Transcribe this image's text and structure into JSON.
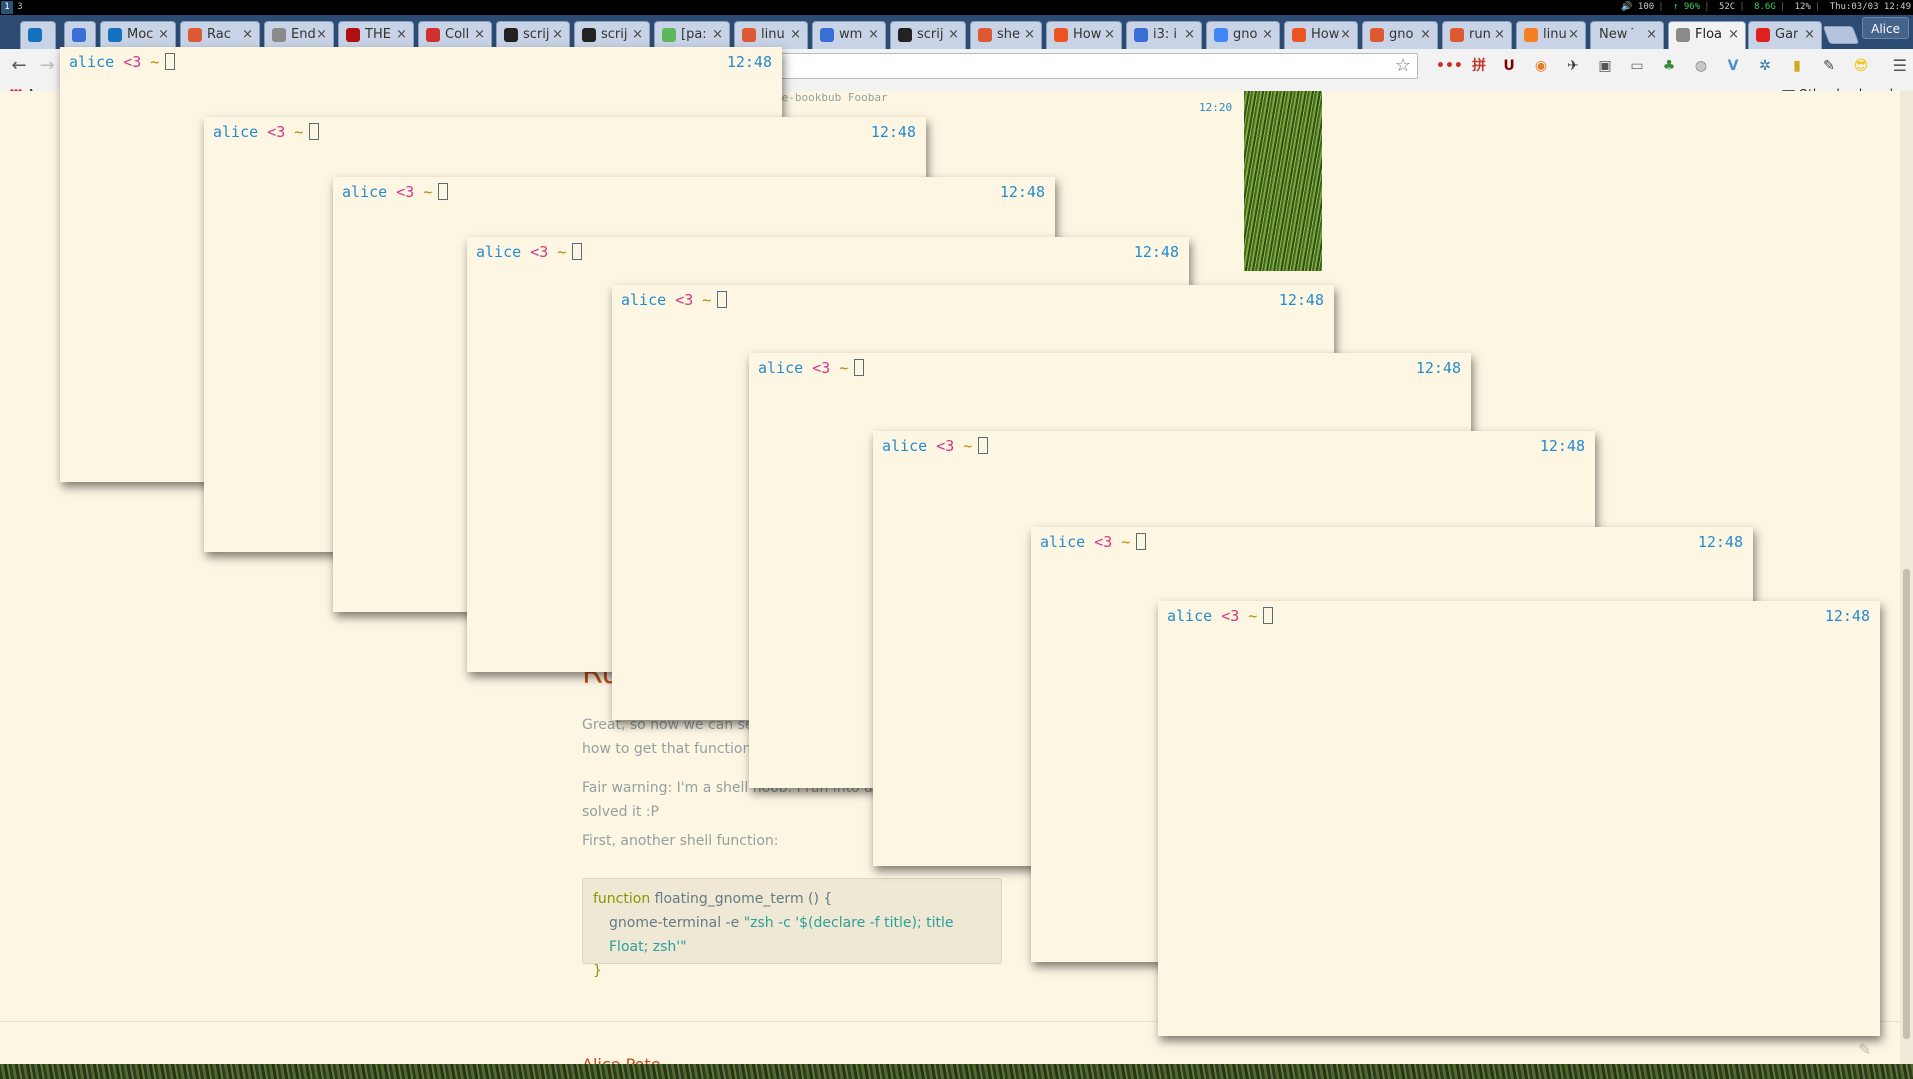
{
  "i3bar": {
    "workspaces": [
      "1",
      "3"
    ],
    "status": {
      "volume": "🔊 100",
      "wifi": "↑ 96%",
      "temp": "52C",
      "mem": "8.6G",
      "cpu": "12%",
      "datetime": "Thu:03/03 12:49"
    }
  },
  "tabs": [
    {
      "label": "",
      "favicon": "trello",
      "color": "#1570c0"
    },
    {
      "label": "",
      "favicon": "calendar",
      "color": "#3a6fd8"
    },
    {
      "label": "Moc",
      "favicon": "trello",
      "color": "#1570c0"
    },
    {
      "label": "Rac",
      "favicon": "duckduckgo",
      "color": "#de5833"
    },
    {
      "label": "End",
      "favicon": "doc",
      "color": "#8a8a8a"
    },
    {
      "label": "THE",
      "favicon": "the",
      "color": "#b01010"
    },
    {
      "label": "Coll",
      "favicon": "bb",
      "color": "#d03030"
    },
    {
      "label": "scrij",
      "favicon": "github",
      "color": "#222222"
    },
    {
      "label": "scrij",
      "favicon": "github",
      "color": "#222222"
    },
    {
      "label": "[pa:",
      "favicon": "check",
      "color": "#5cb85c"
    },
    {
      "label": "linu",
      "favicon": "duckduckgo",
      "color": "#de5833"
    },
    {
      "label": "wm",
      "favicon": "wm",
      "color": "#3a6fd8"
    },
    {
      "label": "scrij",
      "favicon": "github",
      "color": "#222222"
    },
    {
      "label": "she",
      "favicon": "duckduckgo",
      "color": "#de5833"
    },
    {
      "label": "How",
      "favicon": "askubuntu",
      "color": "#e95420"
    },
    {
      "label": "i3: i",
      "favicon": "i3",
      "color": "#3a6fd8"
    },
    {
      "label": "gno",
      "favicon": "google",
      "color": "#4285f4"
    },
    {
      "label": "How",
      "favicon": "askubuntu",
      "color": "#e95420"
    },
    {
      "label": "gno",
      "favicon": "duckduckgo",
      "color": "#de5833"
    },
    {
      "label": "run",
      "favicon": "duckduckgo",
      "color": "#de5833"
    },
    {
      "label": "linu",
      "favicon": "stackoverflow",
      "color": "#f48024"
    },
    {
      "label": "New Ta",
      "favicon": "",
      "color": ""
    },
    {
      "label": "Floa",
      "favicon": "page",
      "color": "#8a8a8a",
      "active": true
    },
    {
      "label": "Gar",
      "favicon": "record",
      "color": "#e02020"
    }
  ],
  "profile": "Alice",
  "toolbar": {
    "back": "←",
    "forward": "→",
    "bookmark_star": "☆",
    "menu": "☰",
    "extensions": [
      {
        "name": "lastpass-icon",
        "glyph": "•••",
        "color": "#d32d27"
      },
      {
        "name": "chinese-input-icon",
        "glyph": "拼",
        "color": "#c0392b"
      },
      {
        "name": "ublock-icon",
        "glyph": "U",
        "color": "#800000"
      },
      {
        "name": "color-picker-icon",
        "glyph": "◉",
        "color": "#e67e22"
      },
      {
        "name": "wrench-extension-icon",
        "glyph": "✈",
        "color": "#333333"
      },
      {
        "name": "screenshot-icon",
        "glyph": "▣",
        "color": "#555555"
      },
      {
        "name": "cast-icon",
        "glyph": "▭",
        "color": "#666666"
      },
      {
        "name": "tree-extension-icon",
        "glyph": "♣",
        "color": "#3a8a3a"
      },
      {
        "name": "globe-icon",
        "glyph": "◍",
        "color": "#888888"
      },
      {
        "name": "vimium-icon",
        "glyph": "V",
        "color": "#4a90d9"
      },
      {
        "name": "network-icon",
        "glyph": "✲",
        "color": "#2a6ea0"
      },
      {
        "name": "highlighter-icon",
        "glyph": "▮",
        "color": "#d4a820"
      },
      {
        "name": "eyedropper-icon",
        "glyph": "✎",
        "color": "#444444"
      },
      {
        "name": "sunglasses-icon",
        "glyph": "😎",
        "color": "#f1c40f"
      }
    ]
  },
  "bookmarks": {
    "apps": "Apps",
    "other": "Other bookmarks"
  },
  "page": {
    "crumb": "ce-bookbub Foobar",
    "prev_time": "12:20",
    "heading_partial": "Ru",
    "para1_line1": "Great, so now we can se",
    "para1_line2": "how to get that function t",
    "para2_line1": "Fair warning: I'm a shell noob. I ran into a t",
    "para2_line2": "solved it :P",
    "para3": "First, another shell function:",
    "code_line1_kw": "function",
    "code_line1_rest": " floating_gnome_term () {",
    "code_line2_cmd": "gnome-terminal -e ",
    "code_line2_str": "\"zsh -c '$(declare -f title); title Float; zsh'\"",
    "code_line3": "}",
    "author": "Alice Pote"
  },
  "terminals": [
    {
      "user": "alice",
      "heart": "<3",
      "dir": "~",
      "time": "12:48"
    },
    {
      "user": "alice",
      "heart": "<3",
      "dir": "~",
      "time": "12:48"
    },
    {
      "user": "alice",
      "heart": "<3",
      "dir": "~",
      "time": "12:48"
    },
    {
      "user": "alice",
      "heart": "<3",
      "dir": "~",
      "time": "12:48"
    },
    {
      "user": "alice",
      "heart": "<3",
      "dir": "~",
      "time": "12:48"
    },
    {
      "user": "alice",
      "heart": "<3",
      "dir": "~",
      "time": "12:48"
    },
    {
      "user": "alice",
      "heart": "<3",
      "dir": "~",
      "time": "12:48"
    },
    {
      "user": "alice",
      "heart": "<3",
      "dir": "~",
      "time": "12:48"
    },
    {
      "user": "alice",
      "heart": "<3",
      "dir": "~",
      "time": "12:48"
    }
  ],
  "colors": {
    "solarized_bg": "#fdf6e3",
    "user": "#268bd2",
    "heart": "#d33682",
    "tilde": "#b58900",
    "accent": "#cb4b16"
  }
}
